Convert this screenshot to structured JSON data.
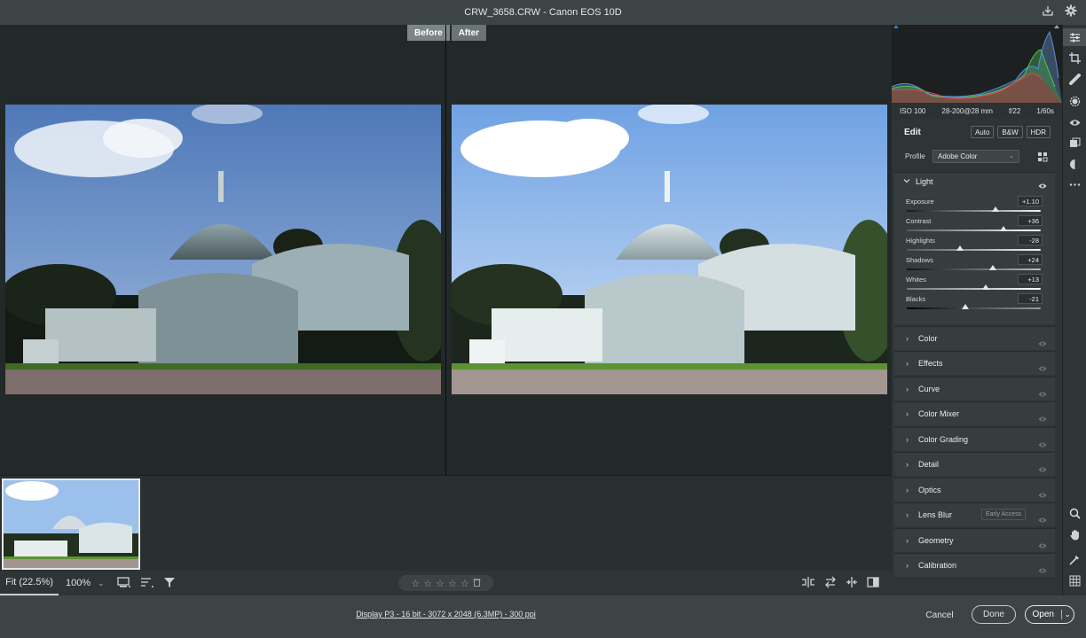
{
  "window": {
    "title": "CRW_3658.CRW  -  Canon EOS 10D",
    "icons": [
      "save-icon",
      "gear-icon"
    ]
  },
  "viewer": {
    "before_label": "Before",
    "after_label": "After"
  },
  "bottombar": {
    "zoom_fit": "Fit (22.5%)",
    "zoom_100": "100%",
    "rating_stars": [
      "☆",
      "☆",
      "☆",
      "☆",
      "☆"
    ],
    "icons_left": [
      "filmstrip-view-icon",
      "sort-icon",
      "filter-icon"
    ],
    "icons_right": [
      "compare-icon",
      "swap-icon",
      "copy-settings-icon",
      "split-view-icon"
    ]
  },
  "status": {
    "file_info": "Display P3 - 16 bit - 3072 x 2048 (6.3MP) - 300 ppi",
    "cancel": "Cancel",
    "done": "Done",
    "open": "Open"
  },
  "camera_info": {
    "iso": "ISO 100",
    "lens": "28-200@28 mm",
    "aperture": "f/22",
    "shutter": "1/60s"
  },
  "edit": {
    "title": "Edit",
    "modes": [
      "Auto",
      "B&W",
      "HDR"
    ],
    "profile_label": "Profile",
    "profile_value": "Adobe Color",
    "light": {
      "title": "Light",
      "sliders": [
        {
          "label": "Exposure",
          "value": "+1.10",
          "position": 0.66
        },
        {
          "label": "Contrast",
          "value": "+36",
          "position": 0.72
        },
        {
          "label": "Highlights",
          "value": "-28",
          "position": 0.4
        },
        {
          "label": "Shadows",
          "value": "+24",
          "position": 0.64
        },
        {
          "label": "Whites",
          "value": "+13",
          "position": 0.59
        },
        {
          "label": "Blacks",
          "value": "-21",
          "position": 0.44
        }
      ]
    },
    "sections": [
      {
        "name": "Color"
      },
      {
        "name": "Effects"
      },
      {
        "name": "Curve"
      },
      {
        "name": "Color Mixer"
      },
      {
        "name": "Color Grading"
      },
      {
        "name": "Detail"
      },
      {
        "name": "Optics"
      },
      {
        "name": "Lens Blur",
        "badge": "Early Access"
      },
      {
        "name": "Geometry"
      },
      {
        "name": "Calibration"
      }
    ]
  },
  "tool_rail": [
    "edit-icon",
    "crop-icon",
    "healing-icon",
    "masking-icon",
    "red-eye-icon",
    "presets-icon",
    "snapshots-icon",
    "more-icon",
    "zoom-icon",
    "hand-icon",
    "sampler-icon",
    "grid-icon"
  ],
  "colors": {
    "accent": "#2f7bd6",
    "panel": "#2f3537",
    "section": "#363d3f"
  }
}
